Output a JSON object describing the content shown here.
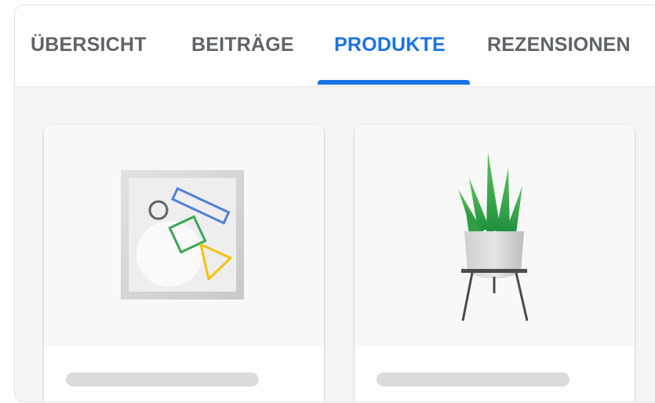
{
  "tabs": [
    {
      "label": "ÜBERSICHT",
      "active": false
    },
    {
      "label": "BEITRÄGE",
      "active": false
    },
    {
      "label": "PRODUKTE",
      "active": true
    },
    {
      "label": "REZENSIONEN",
      "active": false
    }
  ],
  "colors": {
    "accent": "#1a73e8",
    "tab_inactive": "#5f6368",
    "placeholder": "#dcdcdc"
  },
  "products": [
    {
      "image_icon": "geometric-shapes-icon",
      "title_placeholder": true
    },
    {
      "image_icon": "potted-plant-icon",
      "title_placeholder": true
    }
  ]
}
